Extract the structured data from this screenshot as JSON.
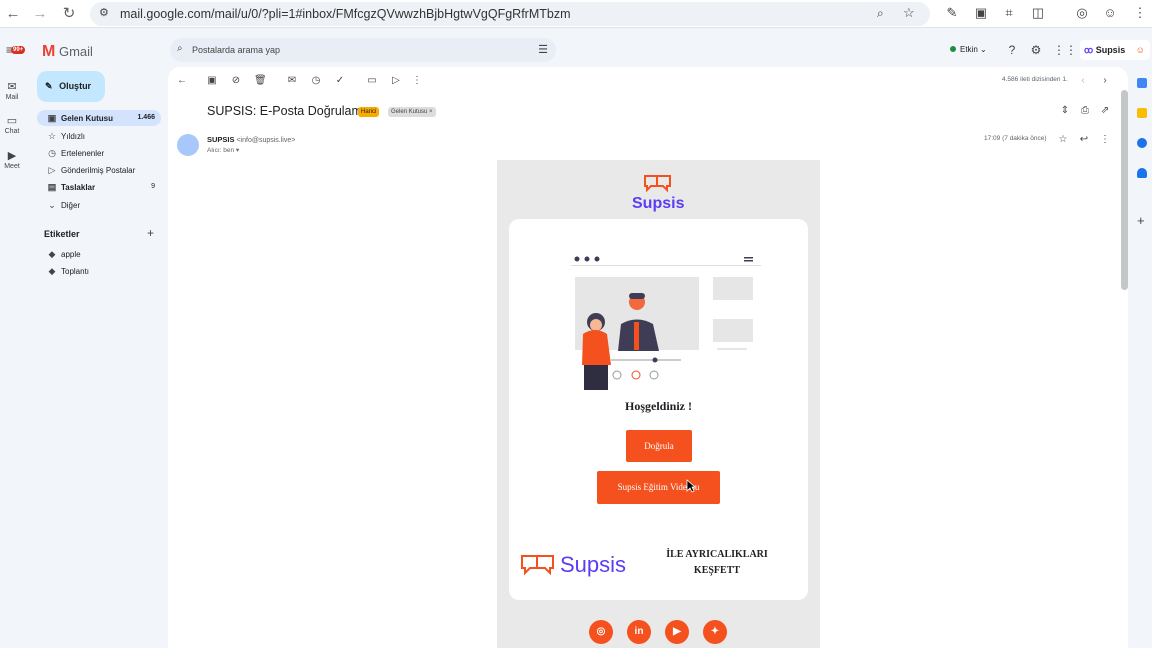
{
  "browser": {
    "url": "mail.google.com/mail/u/0/?pli=1#inbox/FMfcgzQVwwzhBjbHgtwVgQFgRfrMTbzm"
  },
  "app": {
    "name": "Gmail",
    "search_placeholder": "Postalarda arama yap",
    "status": "Etkin",
    "account_brand": "Supsis"
  },
  "rail": {
    "mail": "Mail",
    "chat": "Chat",
    "meet": "Meet",
    "badge": "99+"
  },
  "sidebar": {
    "compose": "Oluştur",
    "items": [
      {
        "label": "Gelen Kutusu",
        "count": "1.466"
      },
      {
        "label": "Yıldızlı",
        "count": ""
      },
      {
        "label": "Ertelenenler",
        "count": ""
      },
      {
        "label": "Gönderilmiş Postalar",
        "count": ""
      },
      {
        "label": "Taslaklar",
        "count": "9"
      },
      {
        "label": "Diğer",
        "count": ""
      }
    ],
    "labels_title": "Etiketler",
    "labels": [
      "apple",
      "Toplantı"
    ]
  },
  "message": {
    "pager": "4.586 ileti dizisinden 1.",
    "subject": "SUPSIS: E-Posta Doğrulama",
    "tags": [
      "Harici",
      "Gelen Kutusu ×"
    ],
    "sender_name": "SUPSIS",
    "sender_email": "<info@supsis.live>",
    "to": "Alıcı: ben",
    "time": "17:09 (7 dakika önce)"
  },
  "email": {
    "brand": "Supsis",
    "welcome": "Hoşgeldiniz !",
    "verify_button": "Doğrula",
    "video_button": "Supsis Eğitim Videosu",
    "footer_brand": "Supsis",
    "footer_line1": "İLE AYRICALIKLARI",
    "footer_line2": "KEŞFETT"
  },
  "colors": {
    "accent": "#f4511e",
    "brand": "#5b3df5",
    "selected": "#d3e3fd"
  }
}
